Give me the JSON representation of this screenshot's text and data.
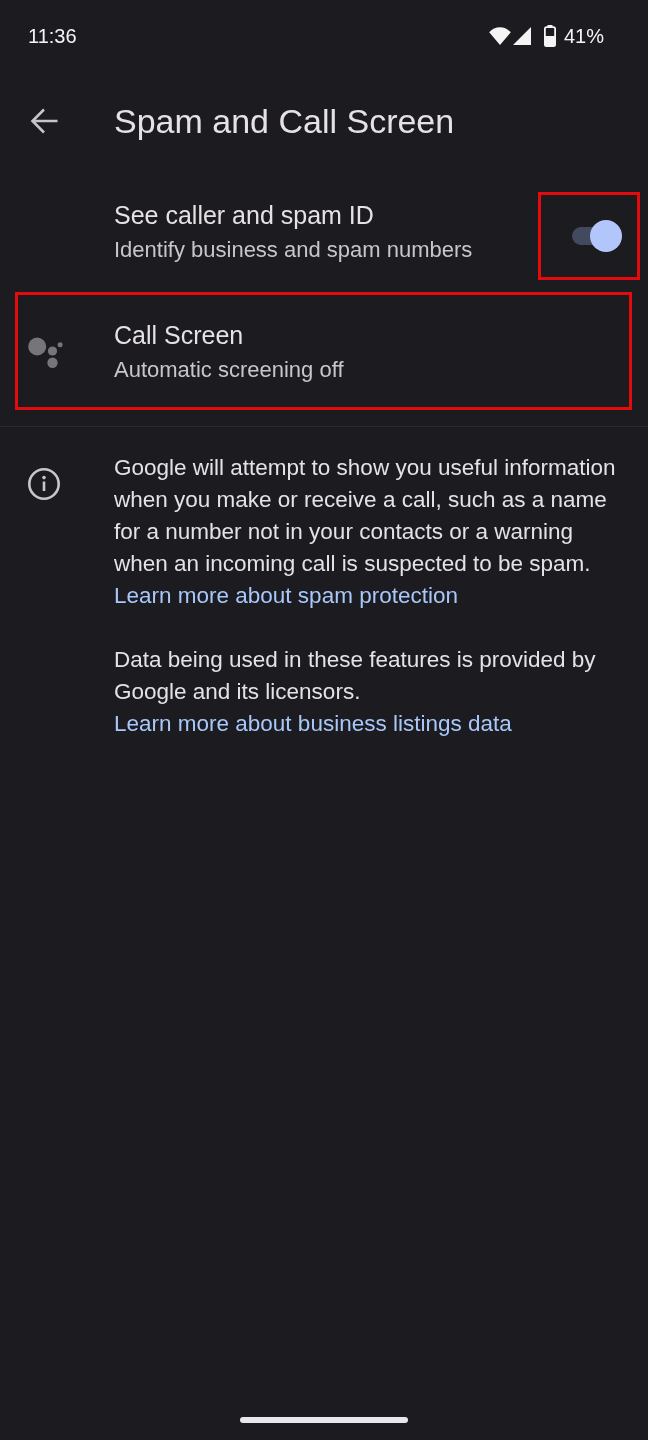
{
  "status_bar": {
    "time": "11:36",
    "battery": "41%"
  },
  "app_bar": {
    "title": "Spam and Call Screen"
  },
  "settings": [
    {
      "kind": "switch",
      "title": "See caller and spam ID",
      "subtitle": "Identify business and spam numbers",
      "on": true,
      "switch_highlighted": true
    },
    {
      "kind": "link",
      "title": "Call Screen",
      "subtitle": "Automatic screening off",
      "highlighted": true
    }
  ],
  "info": {
    "paragraphs": [
      {
        "text": "Google will attempt to show you useful information when you make or receive a call, such as a name for a number not in your contacts or a warning when an incoming call is suspected to be spam.",
        "link": "Learn more about spam protection"
      },
      {
        "text": "Data being used in these features is provided by Google and its licensors.",
        "link": "Learn more about business listings data"
      }
    ]
  }
}
